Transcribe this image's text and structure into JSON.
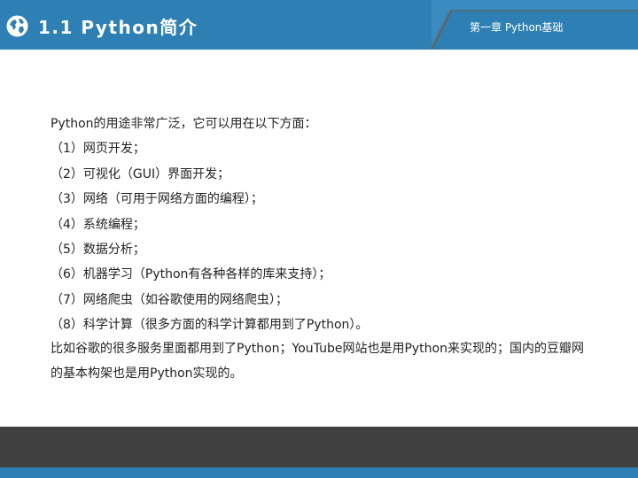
{
  "header": {
    "title": "1.1 Python简介",
    "chapter": "第一章 Python基础",
    "icon": "globe-icon",
    "colors": {
      "bar": "#2e80b4",
      "dark": "#404040"
    }
  },
  "content": {
    "intro": "Python的用途非常广泛，它可以用在以下方面：",
    "items": [
      "（1）网页开发；",
      "（2）可视化（GUI）界面开发；",
      "（3）网络（可用于网络方面的编程）；",
      "（4）系统编程；",
      "（5）数据分析；",
      "（6）机器学习（Python有各种各样的库来支持）；",
      "（7）网络爬虫（如谷歌使用的网络爬虫）；",
      "（8）科学计算（很多方面的科学计算都用到了Python）。"
    ],
    "paragraph": "比如谷歌的很多服务里面都用到了Python；YouTube网站也是用Python来实现的；国内的豆瓣网的基本构架也是用Python实现的。"
  }
}
